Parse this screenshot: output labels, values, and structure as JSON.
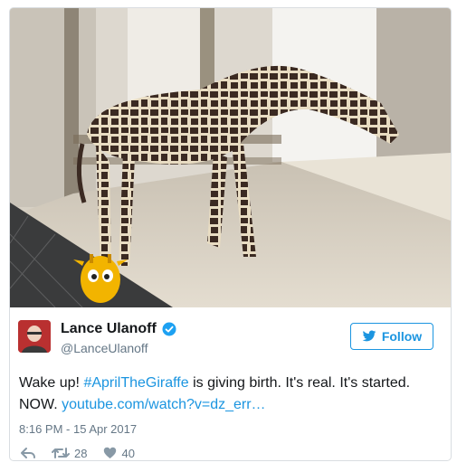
{
  "tweet": {
    "author_name": "Lance Ulanoff",
    "author_handle": "@LanceUlanoff",
    "follow_label": "Follow",
    "text_before": "Wake up! ",
    "hashtag": "#AprilTheGiraffe",
    "text_after": " is giving birth. It's real. It's started. NOW. ",
    "link": "youtube.com/watch?v=dz_err…",
    "timestamp": "8:16 PM - 15 Apr 2017",
    "retweets": "28",
    "likes": "40"
  },
  "colors": {
    "link": "#1b95e0",
    "meta": "#657786",
    "text": "#14171a"
  },
  "icons": [
    "verified-badge-icon",
    "twitter-bird-icon",
    "reply-icon",
    "retweet-icon",
    "heart-icon"
  ]
}
